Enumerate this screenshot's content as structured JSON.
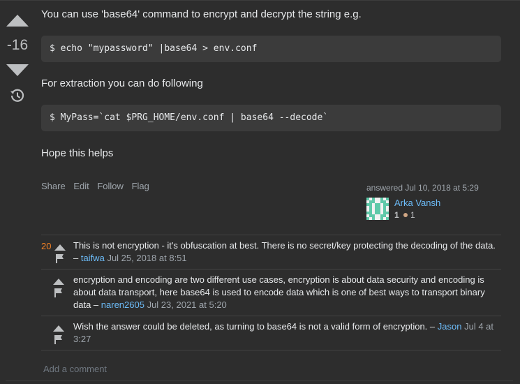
{
  "vote": {
    "count": "-16"
  },
  "post": {
    "p1": "You can use 'base64' command to encrypt and decrypt the string e.g.",
    "code1": "$ echo \"mypassword\" |base64 > env.conf",
    "p2": "For extraction you can do following",
    "code2": "$ MyPass=`cat $PRG_HOME/env.conf | base64 --decode`",
    "p3": "Hope this helps"
  },
  "menu": {
    "share": "Share",
    "edit": "Edit",
    "follow": "Follow",
    "flag": "Flag"
  },
  "signature": {
    "action": "answered Jul 10, 2018 at 5:29",
    "user": "Arka Vansh",
    "reputation": "1",
    "bronze_badges": "1"
  },
  "comments": [
    {
      "score": "20",
      "text": "This is not encryption - it's obfuscation at best. There is no secret/key protecting the decoding of the data.",
      "sep": " – ",
      "user": "taifwa",
      "date": "Jul 25, 2018 at 8:51"
    },
    {
      "score": "",
      "text": "encryption and encoding are two different use cases, encryption is about data security and encoding is about data transport, here base64 is used to encode data which is one of best ways to transport binary data",
      "sep": " – ",
      "user": "naren2605",
      "date": "Jul 23, 2021 at 5:20"
    },
    {
      "score": "",
      "text": "Wish the answer could be deleted, as turning to base64 is not a valid form of encryption.",
      "sep": " – ",
      "user": "Jason",
      "date": "Jul 4 at 3:27"
    }
  ],
  "add_comment": "Add a comment",
  "colors": {
    "link": "#6cbbf7",
    "score": "#f48225",
    "bronze": "#d1a684",
    "code_bg": "#3b3b3b",
    "bg": "#2d2d2d"
  },
  "icons": [
    "arrow-up-icon",
    "arrow-down-icon",
    "history-icon",
    "comment-upvote-icon",
    "flag-icon"
  ]
}
